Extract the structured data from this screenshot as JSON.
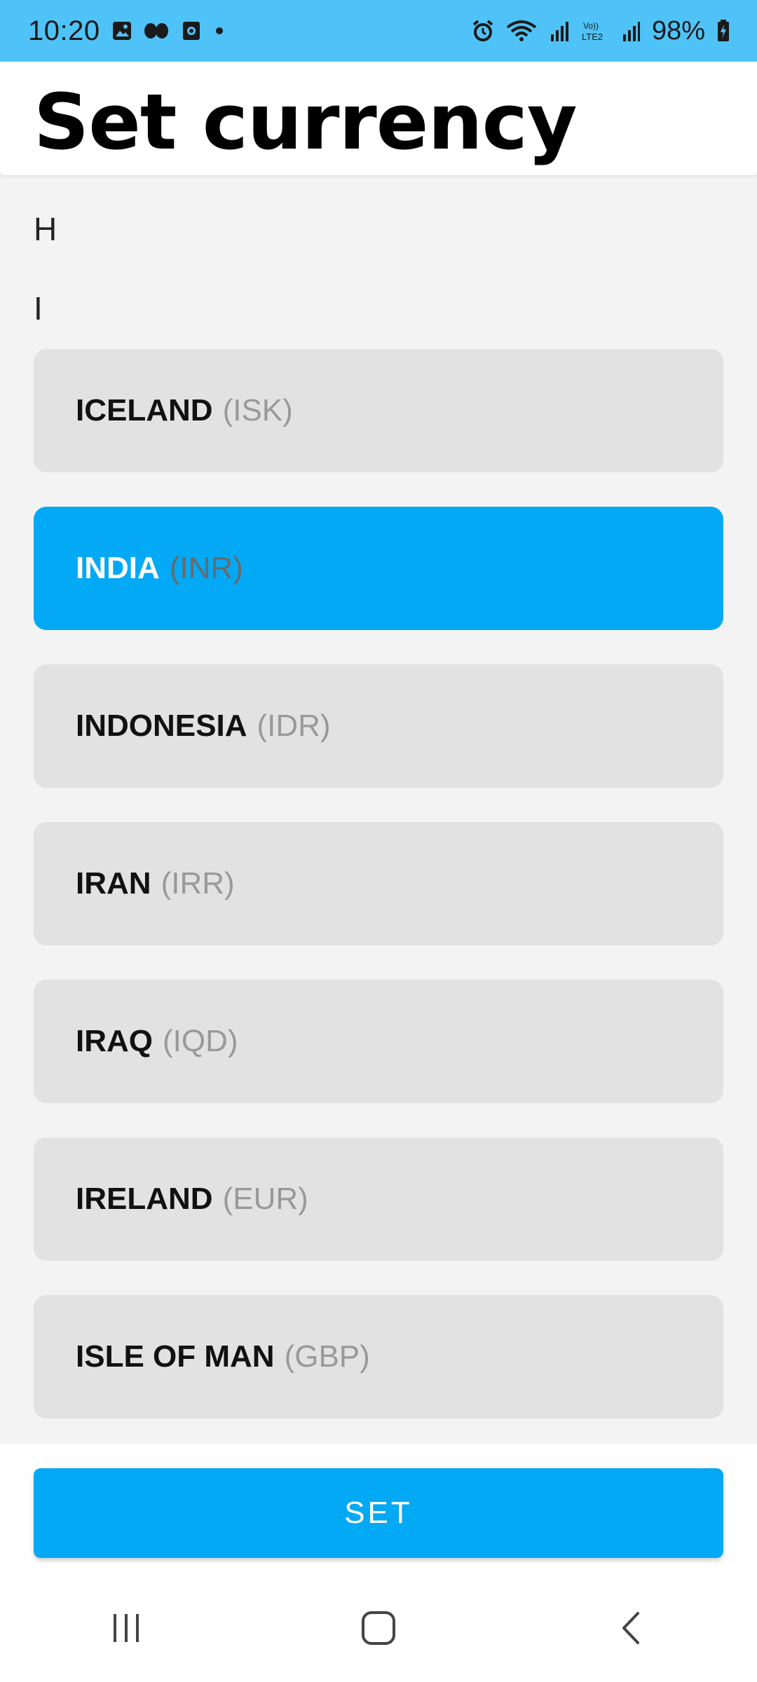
{
  "status_bar": {
    "time": "10:20",
    "battery": "98%",
    "network_label": "LTE2",
    "background": "#4fc3f7"
  },
  "header": {
    "title": "Set currency"
  },
  "sections": [
    {
      "letter": "H"
    },
    {
      "letter": "I"
    }
  ],
  "currencies": [
    {
      "country": "ICELAND",
      "code": "(ISK)",
      "selected": false
    },
    {
      "country": "INDIA",
      "code": "(INR)",
      "selected": true
    },
    {
      "country": "INDONESIA",
      "code": "(IDR)",
      "selected": false
    },
    {
      "country": "IRAN",
      "code": "(IRR)",
      "selected": false
    },
    {
      "country": "IRAQ",
      "code": "(IQD)",
      "selected": false
    },
    {
      "country": "IRELAND",
      "code": "(EUR)",
      "selected": false
    },
    {
      "country": "ISLE OF MAN",
      "code": "(GBP)",
      "selected": false
    }
  ],
  "action": {
    "set_label": "SET"
  },
  "colors": {
    "accent": "#03a9f4",
    "item_bg": "#e2e2e2",
    "page_bg": "#f3f3f3"
  },
  "nav": {
    "icons": [
      "recents-icon",
      "home-icon",
      "back-icon"
    ]
  }
}
